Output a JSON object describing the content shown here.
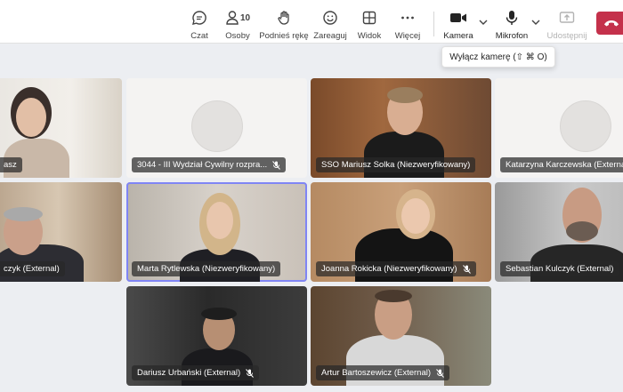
{
  "toolbar": {
    "chat_label": "Czat",
    "people_label": "Osoby",
    "people_count": "10",
    "raise_hand_label": "Podnieś rękę",
    "react_label": "Zareaguj",
    "view_label": "Widok",
    "more_label": "Więcej",
    "camera_label": "Kamera",
    "mic_label": "Mikrofon",
    "share_label": "Udostępnij"
  },
  "tooltip": {
    "text": "Wyłącz kamerę (⇧ ⌘ O)"
  },
  "tiles": [
    {
      "name": "asz",
      "muted": false
    },
    {
      "name": "3044 - III Wydział Cywilny rozpra...",
      "muted": true
    },
    {
      "name": "SSO Mariusz Solka (Niezweryfikowany)",
      "muted": false
    },
    {
      "name": "Katarzyna Karczewska (External)",
      "muted": false
    },
    {
      "name": "czyk (External)",
      "muted": false
    },
    {
      "name": "Marta Rytlewska (Niezweryfikowany)",
      "muted": false
    },
    {
      "name": "Joanna Rokicka (Niezweryfikowany)",
      "muted": true
    },
    {
      "name": "Sebastian Kulczyk (External)",
      "muted": false
    },
    {
      "name": "Dariusz Urbański (External)",
      "muted": true
    },
    {
      "name": "Artur Bartoszewicz (External)",
      "muted": true
    }
  ],
  "colors": {
    "accent": "#7f85f5",
    "leave": "#c4314b"
  }
}
